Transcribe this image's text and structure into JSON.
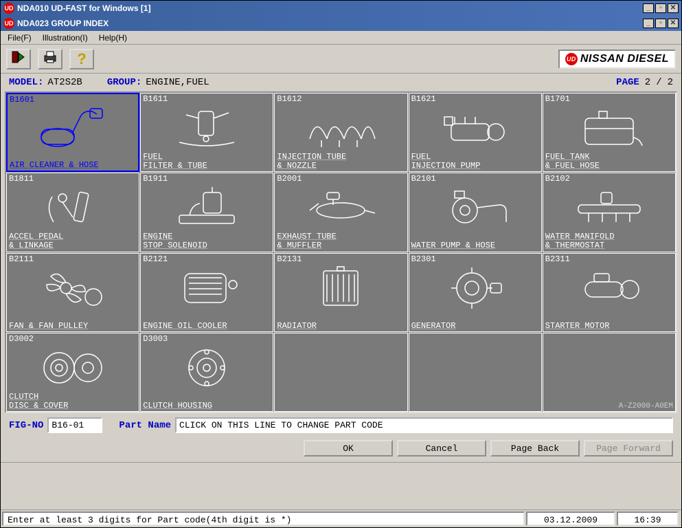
{
  "outer_window": {
    "title": "NDA010 UD-FAST for Windows [1]"
  },
  "inner_window": {
    "title": "NDA023 GROUP INDEX"
  },
  "menubar": {
    "file": "File(F)",
    "illustration": "Illustration(I)",
    "help": "Help(H)"
  },
  "brand": "NISSAN DIESEL",
  "info": {
    "model_label": "MODEL:",
    "model": "AT2S2B",
    "group_label": "GROUP:",
    "group": "ENGINE,FUEL",
    "page_label": "PAGE",
    "page_current": "2",
    "page_total": "2"
  },
  "grid": {
    "watermark": "A-Z2000-A0EM",
    "cells": [
      {
        "code": "B1601",
        "label": "AIR CLEANER & HOSE",
        "selected": true,
        "icon": "air-cleaner"
      },
      {
        "code": "B1611",
        "label": "FUEL\nFILTER & TUBE",
        "icon": "fuel-filter"
      },
      {
        "code": "B1612",
        "label": "INJECTION TUBE\n& NOZZLE",
        "icon": "injection-tube"
      },
      {
        "code": "B1621",
        "label": "FUEL\nINJECTION PUMP",
        "icon": "injection-pump"
      },
      {
        "code": "B1701",
        "label": "FUEL TANK\n& FUEL HOSE",
        "icon": "fuel-tank"
      },
      {
        "code": "B1811",
        "label": "ACCEL PEDAL\n& LINKAGE",
        "icon": "accel-pedal"
      },
      {
        "code": "B1911",
        "label": "ENGINE\nSTOP SOLENOID",
        "icon": "solenoid"
      },
      {
        "code": "B2001",
        "label": "EXHAUST TUBE\n& MUFFLER",
        "icon": "exhaust"
      },
      {
        "code": "B2101",
        "label": "WATER PUMP & HOSE",
        "icon": "water-pump"
      },
      {
        "code": "B2102",
        "label": "WATER MANIFOLD\n& THERMOSTAT",
        "icon": "manifold"
      },
      {
        "code": "B2111",
        "label": "FAN & FAN PULLEY",
        "icon": "fan"
      },
      {
        "code": "B2121",
        "label": "ENGINE OIL COOLER",
        "icon": "oil-cooler"
      },
      {
        "code": "B2131",
        "label": "RADIATOR",
        "icon": "radiator"
      },
      {
        "code": "B2301",
        "label": "GENERATOR",
        "icon": "generator"
      },
      {
        "code": "B2311",
        "label": "STARTER MOTOR",
        "icon": "starter"
      },
      {
        "code": "D3002",
        "label": "CLUTCH\nDISC & COVER",
        "icon": "clutch-disc"
      },
      {
        "code": "D3003",
        "label": "CLUTCH HOUSING",
        "icon": "clutch-housing"
      },
      {
        "code": "",
        "label": "",
        "icon": ""
      },
      {
        "code": "",
        "label": "",
        "icon": ""
      },
      {
        "code": "",
        "label": "",
        "icon": ""
      }
    ]
  },
  "form": {
    "figno_label": "FIG-NO",
    "figno_value": "B16-01",
    "partname_label": "Part Name",
    "partname_value": "CLICK ON THIS LINE TO CHANGE PART CODE"
  },
  "buttons": {
    "ok": "OK",
    "cancel": "Cancel",
    "page_back": "Page Back",
    "page_forward": "Page Forward"
  },
  "status": {
    "message": "Enter at least 3 digits for Part code(4th digit is *)",
    "date": "03.12.2009",
    "time": "16:39"
  }
}
